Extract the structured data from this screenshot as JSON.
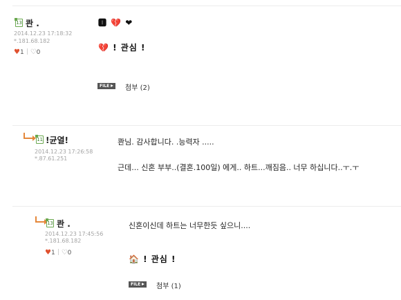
{
  "comments": [
    {
      "level": "13",
      "nick": "콴   .",
      "date": "2014.12.23 17:18:32",
      "ip": "*.181.68.182",
      "likes": "1",
      "dislikes": "0",
      "emoji_line": "🅸 💔 ❤",
      "emoji_line2": "💔 ! 관심 !",
      "attach_badge": "FILE",
      "attach_label": "첨부 (2)"
    },
    {
      "level": "11",
      "nick": "!균열!",
      "date": "2014.12.23 17:26:58",
      "ip": "*.87.61.251",
      "line1": "콴님. 감사합니다. .능력자 .....",
      "line2": "근데... 신혼 부부..(결혼.100일) 에게.. 하트...깨짐음.. 너무 하십니다..ㅜ.ㅜ"
    },
    {
      "level": "13",
      "nick": "콴   .",
      "date": "2014.12.23 17:45:56",
      "ip": "*.181.68.182",
      "likes": "1",
      "dislikes": "0",
      "line1": "신혼이신데 하트는 너무한듯 싶으니....",
      "emoji_line": "🏠 ! 관심 !",
      "attach_badge": "FILE",
      "attach_label": "첨부 (1)"
    }
  ]
}
